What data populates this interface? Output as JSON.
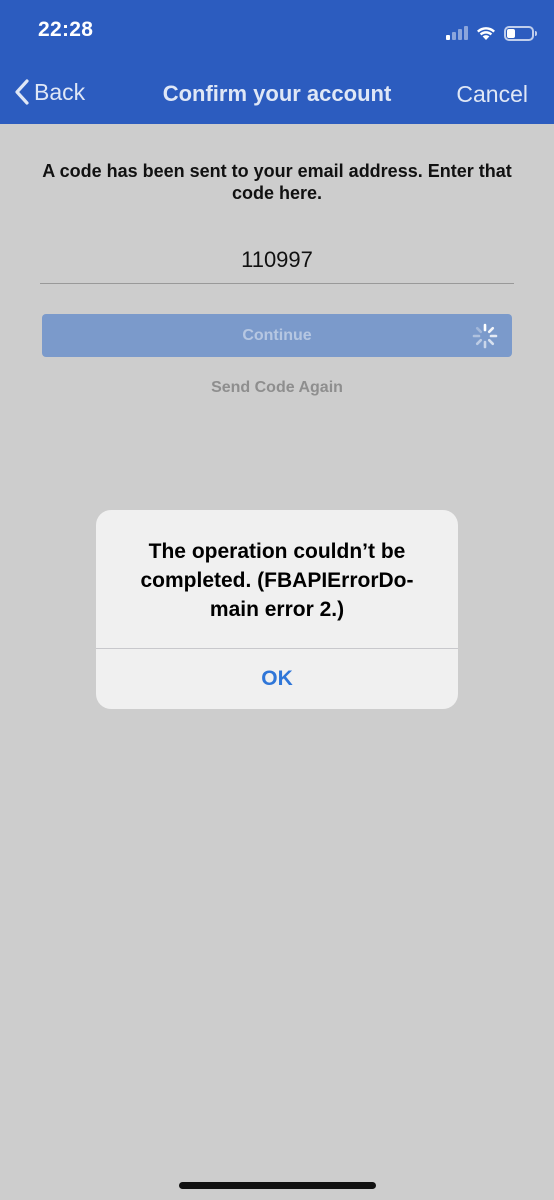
{
  "status_bar": {
    "time": "22:28",
    "icons": [
      "cellular-signal-icon",
      "wifi-icon",
      "battery-icon"
    ],
    "signal_bars_on": 1,
    "battery_level": 0.35
  },
  "nav": {
    "back_label": "Back",
    "title": "Confirm your account",
    "cancel_label": "Cancel"
  },
  "content": {
    "instruction": "A code has been sent to your email address. Enter that code here.",
    "code_value": "110997",
    "continue_label": "Continue",
    "send_again_label": "Send Code Again"
  },
  "alert": {
    "message": "The operation couldn’t be completed. (FBAPIErrorDo-main error 2.)",
    "ok_label": "OK"
  },
  "colors": {
    "header": "#2c5cbf",
    "background": "#cdcdcd",
    "button_disabled": "#7b9acb",
    "alert_action": "#2f76d8"
  }
}
